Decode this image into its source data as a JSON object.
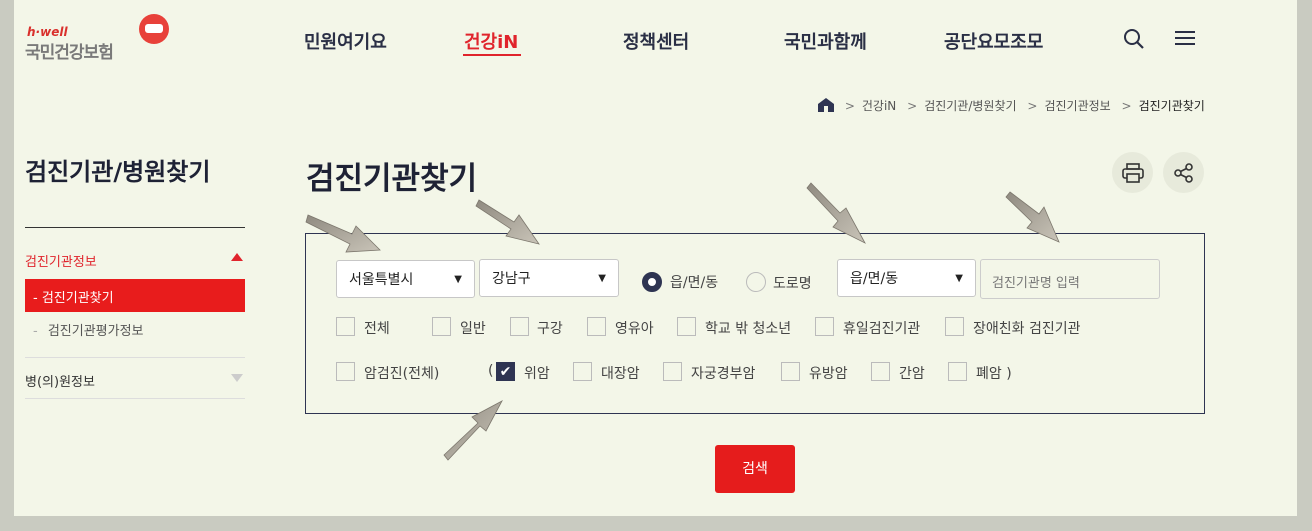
{
  "header": {
    "logo_small": "h·well",
    "logo_main": "국민건강보험",
    "nav": [
      "민원여기요",
      "건강iN",
      "정책센터",
      "국민과함께",
      "공단요모조모"
    ]
  },
  "breadcrumb": [
    "건강iN",
    "검진기관/병원찾기",
    "검진기관정보",
    "검진기관찾기"
  ],
  "sidebar": {
    "title": "검진기관/병원찾기",
    "section1": "검진기관정보",
    "active_item": "검진기관찾기",
    "sub_item": "검진기관평가정보",
    "section2": "병(의)원정보"
  },
  "main": {
    "title": "검진기관찾기",
    "sido": "서울특별시",
    "sigungu": "강남구",
    "radio1": "읍/면/동",
    "radio2": "도로명",
    "dong": "읍/면/동",
    "name_placeholder": "검진기관명 입력",
    "checks_row1": [
      "전체",
      "일반",
      "구강",
      "영유아",
      "학교 밖 청소년",
      "휴일검진기관",
      "장애친화 검진기관"
    ],
    "checks_row2": [
      "암검진(전체)",
      "위암",
      "대장암",
      "자궁경부암",
      "유방암",
      "간암",
      "폐암 )"
    ],
    "paren_open": "(",
    "search_button": "검색"
  },
  "colors": {
    "accent": "#e51c1c",
    "navy": "#2e3452",
    "background": "#f3f6e8"
  },
  "icons": [
    "home-icon",
    "search-icon",
    "menu-icon",
    "print-icon",
    "share-icon",
    "triangle-up-icon",
    "triangle-down-icon",
    "chevron-down-icon",
    "checkmark-icon",
    "annotation-arrow"
  ]
}
